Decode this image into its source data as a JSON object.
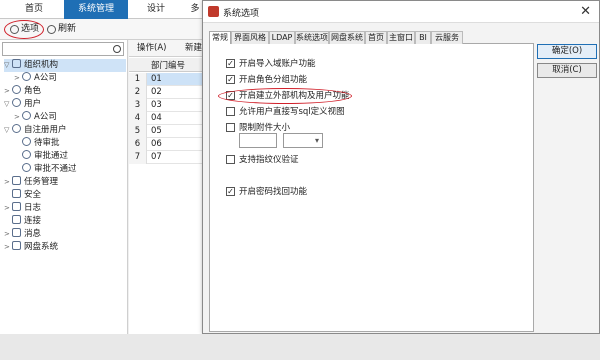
{
  "top_tabs": [
    "首页",
    "系统管理",
    "设计",
    "多"
  ],
  "toolbar": {
    "options_label": "选项",
    "refresh_label": "刷新"
  },
  "tree": {
    "items": [
      {
        "label": "组织机构",
        "arrow": "▽",
        "icon": "org"
      },
      {
        "label": "A公司",
        "arrow": ">",
        "icon": "person"
      },
      {
        "label": "角色",
        "arrow": ">",
        "icon": "role"
      },
      {
        "label": "用户",
        "arrow": "▽",
        "icon": "user"
      },
      {
        "label": "A公司",
        "arrow": ">",
        "icon": "person"
      },
      {
        "label": "自注册用户",
        "arrow": "▽",
        "icon": "user"
      },
      {
        "label": "待审批",
        "arrow": "",
        "icon": "person"
      },
      {
        "label": "审批通过",
        "arrow": "",
        "icon": "person"
      },
      {
        "label": "审批不通过",
        "arrow": "",
        "icon": "person"
      },
      {
        "label": "任务管理",
        "arrow": ">",
        "icon": "gear"
      },
      {
        "label": "安全",
        "arrow": "",
        "icon": "shield"
      },
      {
        "label": "日志",
        "arrow": ">",
        "icon": "log"
      },
      {
        "label": "连接",
        "arrow": "",
        "icon": "link"
      },
      {
        "label": "消息",
        "arrow": ">",
        "icon": "msg"
      },
      {
        "label": "网盘系统",
        "arrow": ">",
        "icon": "cloud"
      }
    ]
  },
  "grid": {
    "op_label": "操作(A)",
    "new_label": "新建",
    "column": "部门编号",
    "rows": [
      "01",
      "02",
      "03",
      "04",
      "05",
      "06",
      "07"
    ],
    "row_numbers": [
      "1",
      "2",
      "3",
      "4",
      "5",
      "6",
      "7"
    ]
  },
  "dialog": {
    "title": "系统选项",
    "tabs": [
      "常规",
      "界面风格",
      "LDAP",
      "系统选项",
      "网盘系统",
      "首页",
      "主窗口",
      "BI",
      "云服务"
    ],
    "options": [
      {
        "label": "开启导入域账户功能",
        "checked": true
      },
      {
        "label": "开启角色分组功能",
        "checked": true
      },
      {
        "label": "开启建立外部机构及用户功能",
        "checked": true
      },
      {
        "label": "允许用户直接写sql定义视图",
        "checked": false
      },
      {
        "label": "限制附件大小",
        "checked": false
      },
      {
        "label": "支持指纹仪验证",
        "checked": false
      },
      {
        "label": "开启密码找回功能",
        "checked": true
      }
    ],
    "ok_label": "确定(O)",
    "cancel_label": "取消(C)"
  },
  "colors": {
    "accent": "#1f6fb5",
    "highlight": "#d0202a"
  }
}
